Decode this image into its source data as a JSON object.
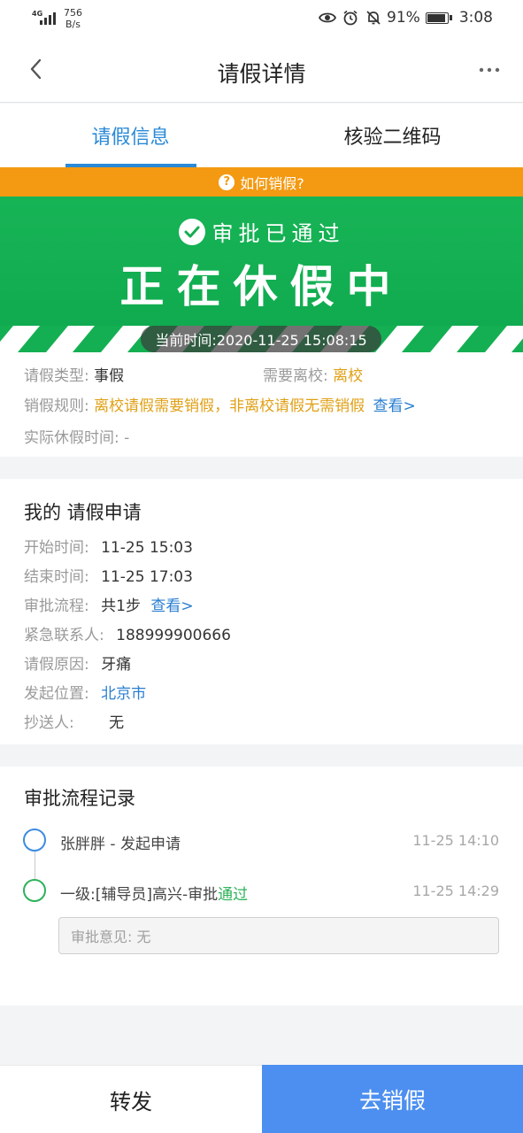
{
  "status_bar": {
    "network_type": "4G",
    "net_speed_value": "756",
    "net_speed_unit": "B/s",
    "battery": "91%",
    "time": "3:08",
    "icons": [
      "eye-icon",
      "alarm-icon",
      "bell-off-icon",
      "battery-icon"
    ]
  },
  "header": {
    "title": "请假详情",
    "more_label": "···"
  },
  "tabs": [
    {
      "label": "请假信息",
      "active": true
    },
    {
      "label": "核验二维码",
      "active": false
    }
  ],
  "howto_banner": {
    "icon_text": "?",
    "label": "如何销假?"
  },
  "hero": {
    "approved_label": "审批已通过",
    "status_label": "正在休假中",
    "current_time": "当前时间:2020-11-25 15:08:15"
  },
  "info": {
    "leave_type_label": "请假类型:",
    "leave_type_value": "事假",
    "need_leave_school_label": "需要离校:",
    "need_leave_school_value": "离校",
    "cancel_rule_label": "销假规则:",
    "cancel_rule_value": "离校请假需要销假，非离校请假无需销假",
    "cancel_rule_link": "查看>",
    "actual_time_label": "实际休假时间:",
    "actual_time_value": "-"
  },
  "application": {
    "title": "我的 请假申请",
    "fields": [
      {
        "label": "开始时间:",
        "value": "11-25 15:03"
      },
      {
        "label": "结束时间:",
        "value": "11-25 17:03"
      },
      {
        "label": "审批流程:",
        "value": "共1步",
        "link": "查看>"
      },
      {
        "label": "紧急联系人:",
        "value": "188999900666"
      },
      {
        "label": "请假原因:",
        "value": "牙痛"
      },
      {
        "label": "发起位置:",
        "value": "北京市"
      },
      {
        "label": "抄送人:",
        "value": "无"
      }
    ]
  },
  "records": {
    "title": "审批流程记录",
    "items": [
      {
        "text": "张胖胖 - 发起申请",
        "time": "11-25 14:10",
        "color": "#3d8be0"
      },
      {
        "text": "一级:[辅导员]高兴-审批",
        "result": "通过",
        "time": "11-25 14:29",
        "color": "#2db259"
      }
    ],
    "opinion": "审批意见: 无"
  },
  "bottom": {
    "forward_label": "转发",
    "cancel_leave_label": "去销假"
  },
  "colors": {
    "accent_blue": "#2a8ad8",
    "orange_banner": "#f39a12",
    "green_hero": "#17b456",
    "primary_button": "#4c8ff0"
  }
}
